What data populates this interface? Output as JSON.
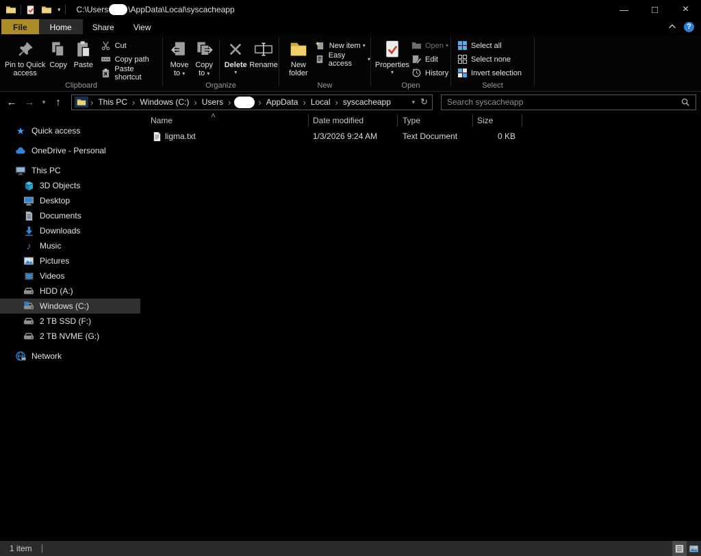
{
  "titlebar": {
    "path_prefix": "C:\\Users",
    "path_suffix": "\\AppData\\Local\\syscacheapp",
    "controls": {
      "minimize": "—",
      "maximize": "□",
      "close": "×"
    }
  },
  "tabs": {
    "file": "File",
    "home": "Home",
    "share": "Share",
    "view": "View",
    "help": "?"
  },
  "icons": {
    "dropdown": "▾",
    "back": "←",
    "forward": "→",
    "up": "↑",
    "refresh": "↻",
    "crumb_sep": "›",
    "sort_up": "˄"
  },
  "ribbon": {
    "clipboard": {
      "label": "Clipboard",
      "pin": "Pin to Quick access",
      "copy": "Copy",
      "paste": "Paste",
      "cut": "Cut",
      "copy_path": "Copy path",
      "paste_shortcut": "Paste shortcut"
    },
    "organize": {
      "label": "Organize",
      "move_to": "Move to",
      "copy_to": "Copy to",
      "delete": "Delete",
      "rename": "Rename"
    },
    "new_group": {
      "label": "New",
      "new_folder": "New folder",
      "new_item": "New item",
      "easy_access": "Easy access"
    },
    "open_group": {
      "label": "Open",
      "properties": "Properties",
      "open": "Open",
      "edit": "Edit",
      "history": "History"
    },
    "select_group": {
      "label": "Select",
      "select_all": "Select all",
      "select_none": "Select none",
      "invert": "Invert selection"
    }
  },
  "breadcrumb": {
    "items": [
      "This PC",
      "Windows (C:)",
      "Users",
      "AppData",
      "Local",
      "syscacheapp"
    ]
  },
  "search": {
    "placeholder": "Search syscacheapp"
  },
  "sidebar": {
    "items": [
      {
        "label": "Quick access"
      },
      {
        "label": "OneDrive - Personal"
      },
      {
        "label": "This PC"
      },
      {
        "label": "3D Objects"
      },
      {
        "label": "Desktop"
      },
      {
        "label": "Documents"
      },
      {
        "label": "Downloads"
      },
      {
        "label": "Music"
      },
      {
        "label": "Pictures"
      },
      {
        "label": "Videos"
      },
      {
        "label": "HDD (A:)"
      },
      {
        "label": "Windows (C:)"
      },
      {
        "label": "2 TB SSD (F:)"
      },
      {
        "label": "2 TB NVME (G:)"
      },
      {
        "label": "Network"
      }
    ]
  },
  "files": {
    "columns": {
      "name": "Name",
      "date_modified": "Date modified",
      "type": "Type",
      "size": "Size"
    },
    "rows": [
      {
        "name": "ligma.txt",
        "date_modified": "1/3/2026 9:24 AM",
        "type": "Text Document",
        "size": "0 KB"
      }
    ]
  },
  "statusbar": {
    "count": "1 item"
  }
}
